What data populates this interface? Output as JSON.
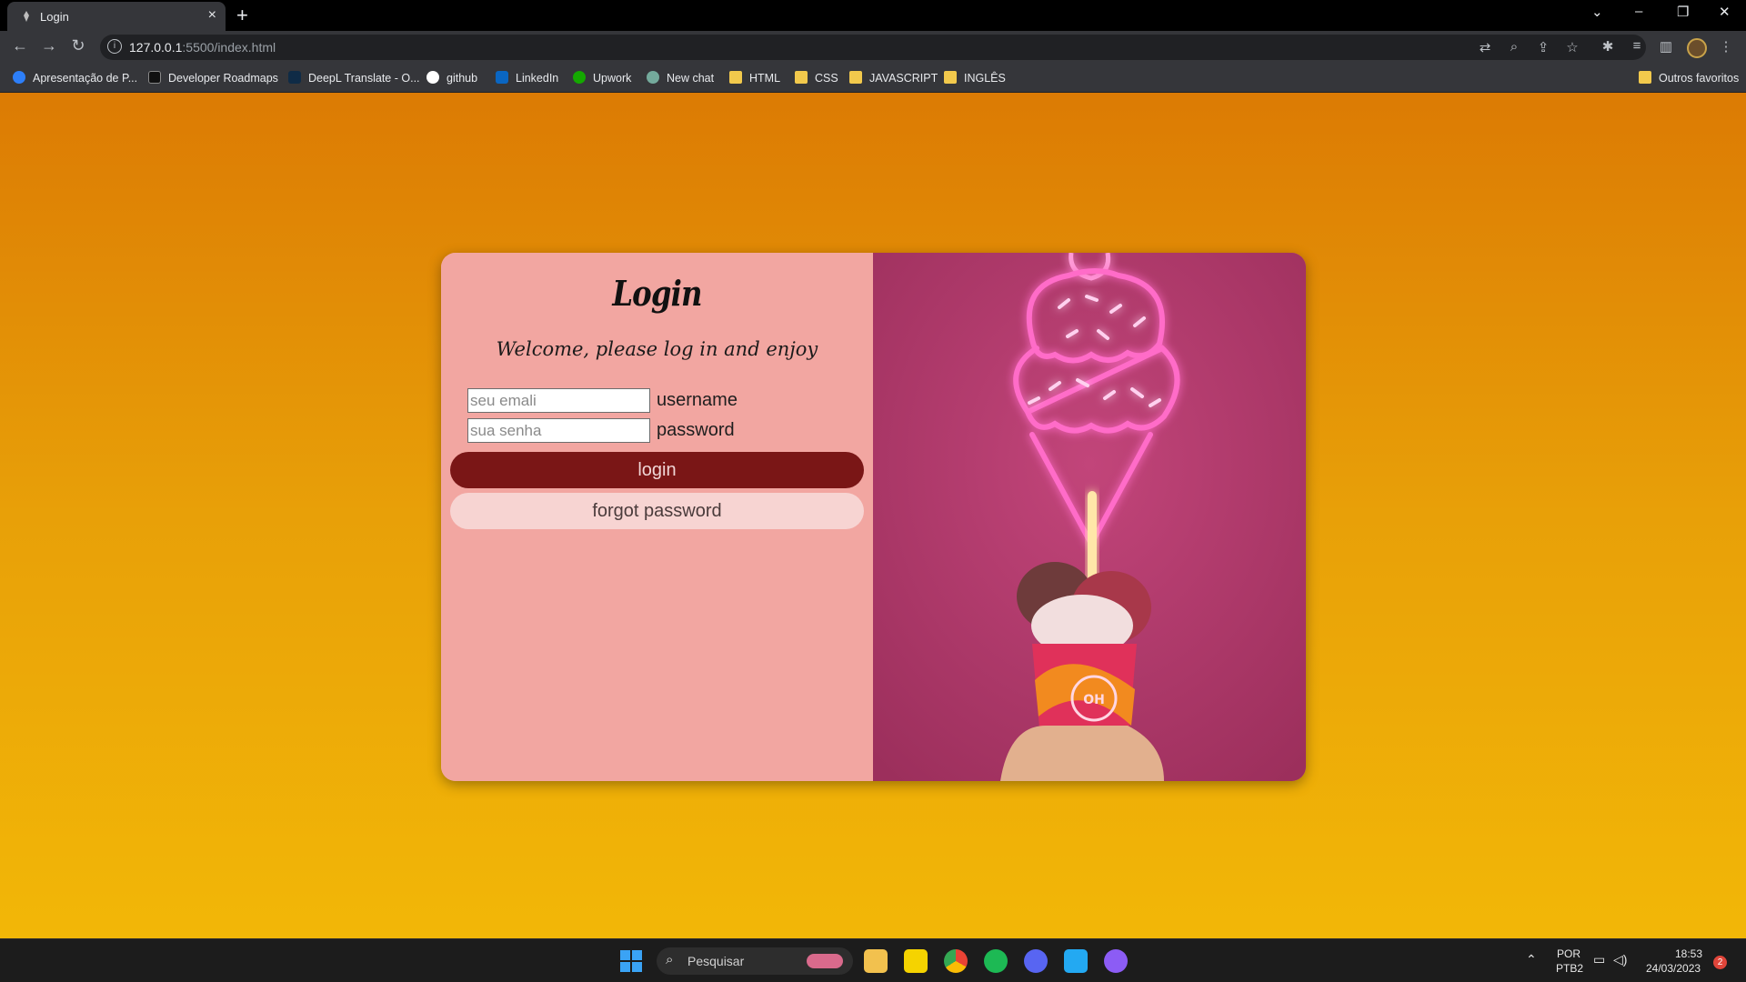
{
  "browser": {
    "tab_title": "Login",
    "new_tab": "+",
    "address": {
      "host": "127.0.0.1",
      "path": ":5500/index.html"
    },
    "bookmarks": [
      {
        "label": "Apresentação de P...",
        "icon": "canva-icon",
        "color": "#2d7ff9"
      },
      {
        "label": "Developer Roadmaps",
        "icon": "roadmap-icon",
        "color": "#111111"
      },
      {
        "label": "DeepL Translate - O...",
        "icon": "deepl-icon",
        "color": "#0f2b46"
      },
      {
        "label": "github",
        "icon": "github-icon",
        "color": "#ffffff"
      },
      {
        "label": "LinkedIn",
        "icon": "linkedin-icon",
        "color": "#0a66c2"
      },
      {
        "label": "Upwork",
        "icon": "upwork-icon",
        "color": "#14a800"
      },
      {
        "label": "New chat",
        "icon": "chatgpt-icon",
        "color": "#74aa9c"
      },
      {
        "label": "HTML",
        "icon": "folder-icon",
        "color": "#f2c94c"
      },
      {
        "label": "CSS",
        "icon": "folder-icon",
        "color": "#f2c94c"
      },
      {
        "label": "JAVASCRIPT",
        "icon": "folder-icon",
        "color": "#f2c94c"
      },
      {
        "label": "INGLÊS",
        "icon": "folder-icon",
        "color": "#f2c94c"
      }
    ],
    "other_bookmarks": "Outros favoritos"
  },
  "page": {
    "title": "Login",
    "subtitle": "Welcome, please log in and enjoy",
    "email": {
      "placeholder": "seu emali",
      "label": "username"
    },
    "password": {
      "placeholder": "sua senha",
      "label": "password"
    },
    "login_button": "login",
    "forgot_button": "forgot password",
    "colors": {
      "background_top": "#dc7b04",
      "background_bottom": "#f2b707",
      "panel": "#f2a6a1",
      "login_button": "#7a1616",
      "neon": "#ff3fb0"
    }
  },
  "taskbar": {
    "search_placeholder": "Pesquisar",
    "language": "POR",
    "keyboard": "PTB2",
    "time": "18:53",
    "date": "24/03/2023",
    "notifications": "2"
  }
}
